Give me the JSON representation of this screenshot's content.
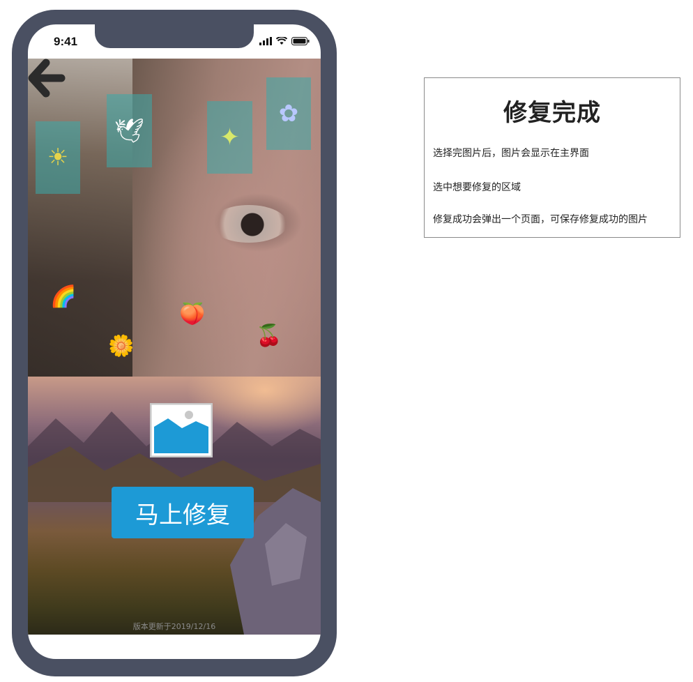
{
  "status_bar": {
    "time": "9:41"
  },
  "stickers": [
    {
      "name": "sun-sticker",
      "glyph": "☀"
    },
    {
      "name": "dove-sticker",
      "glyph": "🕊"
    },
    {
      "name": "sparkle-sticker",
      "glyph": "✦"
    },
    {
      "name": "flower-sticker",
      "glyph": "✿"
    }
  ],
  "emojis": [
    {
      "name": "rainbow-icon",
      "glyph": "🌈"
    },
    {
      "name": "peach-icon",
      "glyph": "🍑"
    },
    {
      "name": "cherry-icon",
      "glyph": "🍒"
    },
    {
      "name": "sunflower-icon",
      "glyph": "🌼"
    }
  ],
  "main": {
    "fix_button_label": "马上修复",
    "version_text": "版本更新于2019/12/16"
  },
  "info_panel": {
    "title": "修复完成",
    "lines": [
      "选择完图片后，图片会显示在主界面",
      "选中想要修复的区域",
      "修复成功会弹出一个页面，可保存修复成功的图片"
    ]
  },
  "colors": {
    "phone_frame": "#4a5062",
    "button_blue": "#1d9ad6",
    "sticker_teal": "#3aaaaa"
  }
}
